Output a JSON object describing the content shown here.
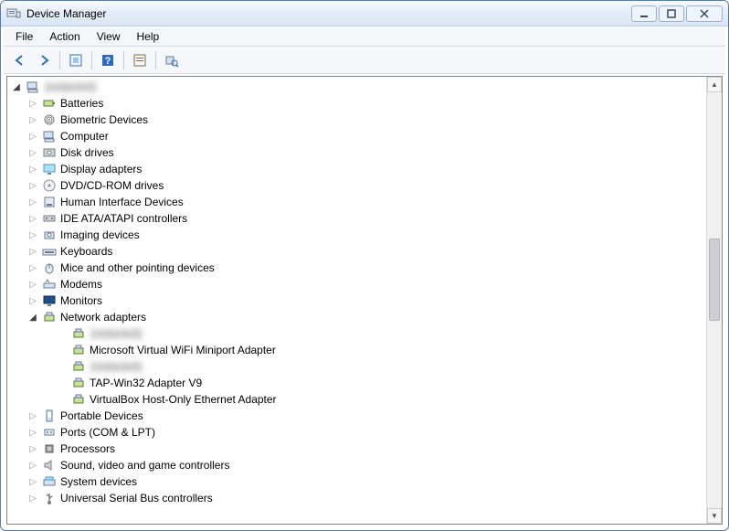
{
  "window": {
    "title": "Device Manager"
  },
  "menu": {
    "file": "File",
    "action": "Action",
    "view": "View",
    "help": "Help"
  },
  "toolbar": {
    "back": "Back",
    "forward": "Forward",
    "up": "Up one level",
    "help": "Help",
    "properties": "Properties",
    "scan": "Scan for hardware changes"
  },
  "tree": {
    "root_label": "(redacted)",
    "categories": [
      {
        "label": "Batteries",
        "icon": "battery"
      },
      {
        "label": "Biometric Devices",
        "icon": "fingerprint"
      },
      {
        "label": "Computer",
        "icon": "computer"
      },
      {
        "label": "Disk drives",
        "icon": "disk"
      },
      {
        "label": "Display adapters",
        "icon": "display"
      },
      {
        "label": "DVD/CD-ROM drives",
        "icon": "cdrom"
      },
      {
        "label": "Human Interface Devices",
        "icon": "hid"
      },
      {
        "label": "IDE ATA/ATAPI controllers",
        "icon": "ide"
      },
      {
        "label": "Imaging devices",
        "icon": "camera"
      },
      {
        "label": "Keyboards",
        "icon": "keyboard"
      },
      {
        "label": "Mice and other pointing devices",
        "icon": "mouse"
      },
      {
        "label": "Modems",
        "icon": "modem"
      },
      {
        "label": "Monitors",
        "icon": "monitor"
      },
      {
        "label": "Network adapters",
        "icon": "network",
        "expanded": true
      },
      {
        "label": "Portable Devices",
        "icon": "portable"
      },
      {
        "label": "Ports (COM & LPT)",
        "icon": "port"
      },
      {
        "label": "Processors",
        "icon": "cpu"
      },
      {
        "label": "Sound, video and game controllers",
        "icon": "sound"
      },
      {
        "label": "System devices",
        "icon": "system"
      },
      {
        "label": "Universal Serial Bus controllers",
        "icon": "usb"
      }
    ],
    "network_children": [
      {
        "label": "(redacted)",
        "redacted": true
      },
      {
        "label": "Microsoft Virtual WiFi Miniport Adapter"
      },
      {
        "label": "(redacted)",
        "redacted": true
      },
      {
        "label": "TAP-Win32 Adapter V9"
      },
      {
        "label": "VirtualBox Host-Only Ethernet Adapter"
      }
    ]
  }
}
